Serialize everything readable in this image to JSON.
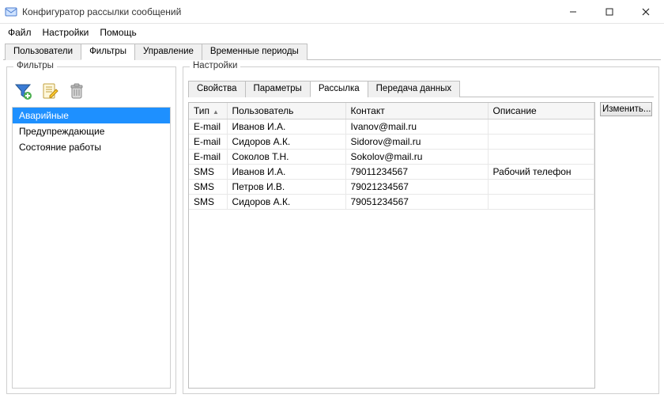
{
  "window": {
    "title": "Конфигуратор рассылки сообщений"
  },
  "menu": {
    "file": "Файл",
    "settings": "Настройки",
    "help": "Помощь"
  },
  "main_tabs": {
    "users": "Пользователи",
    "filters": "Фильтры",
    "control": "Управление",
    "time_periods": "Временные периоды"
  },
  "left": {
    "group_title": "Фильтры",
    "icons": {
      "add": "add-filter",
      "edit": "edit-filter",
      "delete": "delete-filter"
    },
    "items": [
      {
        "label": "Аварийные",
        "selected": true
      },
      {
        "label": "Предупреждающие",
        "selected": false
      },
      {
        "label": "Состояние работы",
        "selected": false
      }
    ]
  },
  "right": {
    "group_title": "Настройки",
    "tabs": {
      "props": "Свойства",
      "params": "Параметры",
      "mailing": "Рассылка",
      "transfer": "Передача данных"
    },
    "columns": {
      "type": "Тип",
      "user": "Пользователь",
      "contact": "Контакт",
      "descr": "Описание"
    },
    "rows": [
      {
        "type": "E-mail",
        "user": "Иванов И.А.",
        "contact": "Ivanov@mail.ru",
        "descr": ""
      },
      {
        "type": "E-mail",
        "user": "Сидоров А.К.",
        "contact": "Sidorov@mail.ru",
        "descr": ""
      },
      {
        "type": "E-mail",
        "user": "Соколов Т.Н.",
        "contact": "Sokolov@mail.ru",
        "descr": ""
      },
      {
        "type": "SMS",
        "user": "Иванов И.А.",
        "contact": "79011234567",
        "descr": "Рабочий телефон"
      },
      {
        "type": "SMS",
        "user": "Петров И.В.",
        "contact": "79021234567",
        "descr": ""
      },
      {
        "type": "SMS",
        "user": "Сидоров А.К.",
        "contact": "79051234567",
        "descr": ""
      }
    ],
    "button_change": "Изменить..."
  }
}
